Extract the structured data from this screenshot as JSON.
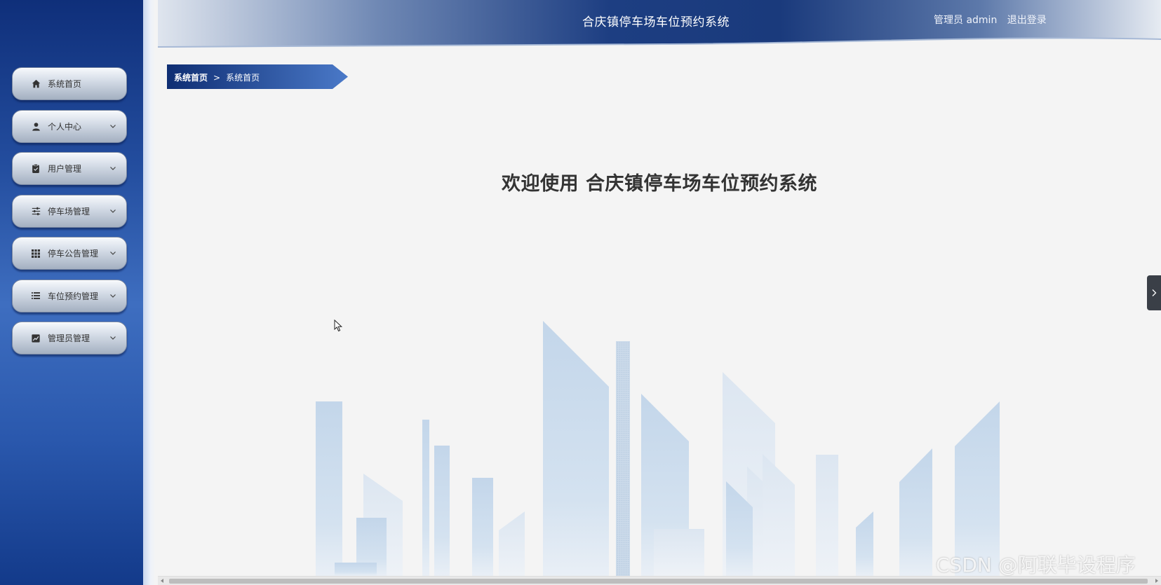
{
  "header": {
    "title": "合庆镇停车场车位预约系统",
    "user_label": "管理员 admin",
    "logout_label": "退出登录"
  },
  "sidebar": {
    "items": [
      {
        "label": "系统首页",
        "icon": "home-icon",
        "has_submenu": false
      },
      {
        "label": "个人中心",
        "icon": "user-icon",
        "has_submenu": true
      },
      {
        "label": "用户管理",
        "icon": "clipboard-icon",
        "has_submenu": true
      },
      {
        "label": "停车场管理",
        "icon": "sliders-icon",
        "has_submenu": true
      },
      {
        "label": "停车公告管理",
        "icon": "grid-icon",
        "has_submenu": true
      },
      {
        "label": "车位预约管理",
        "icon": "list-icon",
        "has_submenu": true
      },
      {
        "label": "管理员管理",
        "icon": "chart-icon",
        "has_submenu": true
      }
    ]
  },
  "breadcrumb": {
    "home": "系统首页",
    "separator": ">",
    "current": "系统首页"
  },
  "main": {
    "welcome": "欢迎使用 合庆镇停车场车位预约系统"
  },
  "watermark": "CSDN @阿联毕设程序",
  "colors": {
    "sidebar_dark": "#0f2f7a",
    "sidebar_mid": "#3e6ec0",
    "header_blue": "#1d3e82",
    "page_bg": "#f4f4f4",
    "skyline": "#c5d6e8"
  }
}
